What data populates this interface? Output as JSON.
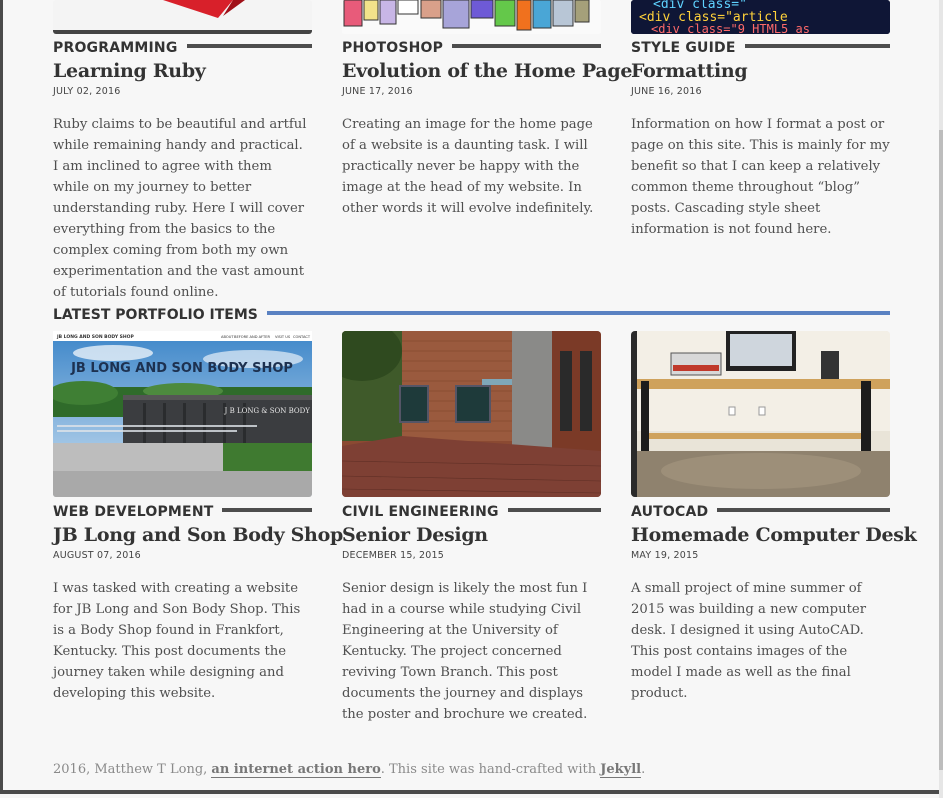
{
  "posts": [
    {
      "category": "PROGRAMMING",
      "title": "Learning Ruby",
      "date": "JULY 02, 2016",
      "excerpt": "Ruby claims to be beautiful and artful while remaining handy and practical. I am inclined to agree with them while on my journey to better understanding ruby. Here I will cover everything from the basics to the complex coming from both my own experimentation and the vast amount of tutorials found online."
    },
    {
      "category": "PHOTOSHOP",
      "title": "Evolution of the Home Page",
      "date": "JUNE 17, 2016",
      "excerpt": "Creating an image for the home page of a website is a daunting task. I will practically never be happy with the image at the head of my website. In other words it will evolve indefinitely."
    },
    {
      "category": "STYLE GUIDE",
      "title": "Formatting",
      "date": "JUNE 16, 2016",
      "excerpt": "Information on how I format a post or page on this site. This is mainly for my benefit so that I can keep a relatively common theme throughout “blog” posts. Cascading style sheet information is not found here."
    }
  ],
  "section": {
    "title": "LATEST PORTFOLIO ITEMS"
  },
  "portfolio": [
    {
      "category": "WEB DEVELOPMENT",
      "title": "JB Long and Son Body Shop",
      "date": "AUGUST 07, 2016",
      "excerpt": "I was tasked with creating a website for JB Long and Son Body Shop. This is a Body Shop found in Frankfort, Kentucky. This post documents the journey taken while designing and developing this website.",
      "thumb": {
        "brand": "JB LONG AND SON BODY SHOP",
        "nav": [
          "ABOUT",
          "BEFORE AND AFTER",
          "VISIT US",
          "CONTACT"
        ],
        "headline": "JB LONG AND SON BODY SHOP",
        "sign": "J B LONG & SON BODY SHOP"
      }
    },
    {
      "category": "CIVIL ENGINEERING",
      "title": "Senior Design",
      "date": "DECEMBER 15, 2015",
      "excerpt": "Senior design is likely the most fun I had in a course while studying Civil Engineering at the University of Kentucky. The project concerned reviving Town Branch. This post documents the journey and displays the poster and brochure we created."
    },
    {
      "category": "AUTOCAD",
      "title": "Homemade Computer Desk",
      "date": "MAY 19, 2015",
      "excerpt": "A small project of mine summer of 2015 was building a new computer desk. I designed it using AutoCAD. This post contains images of the model I made as well as the final product."
    }
  ],
  "thumbs_top": {
    "code_lines": [
      "<div class=\"",
      "<div class=\"article",
      "<div class=\"9 HTML5 as"
    ]
  },
  "footer": {
    "prefix": "2016, Matthew T Long, ",
    "link1": "an internet action hero",
    "middle": ". This site was hand-crafted with ",
    "link2": "Jekyll",
    "suffix": "."
  },
  "colors": {
    "accent_blue": "#5a82c2",
    "rule_dark": "#4d4d4d"
  }
}
